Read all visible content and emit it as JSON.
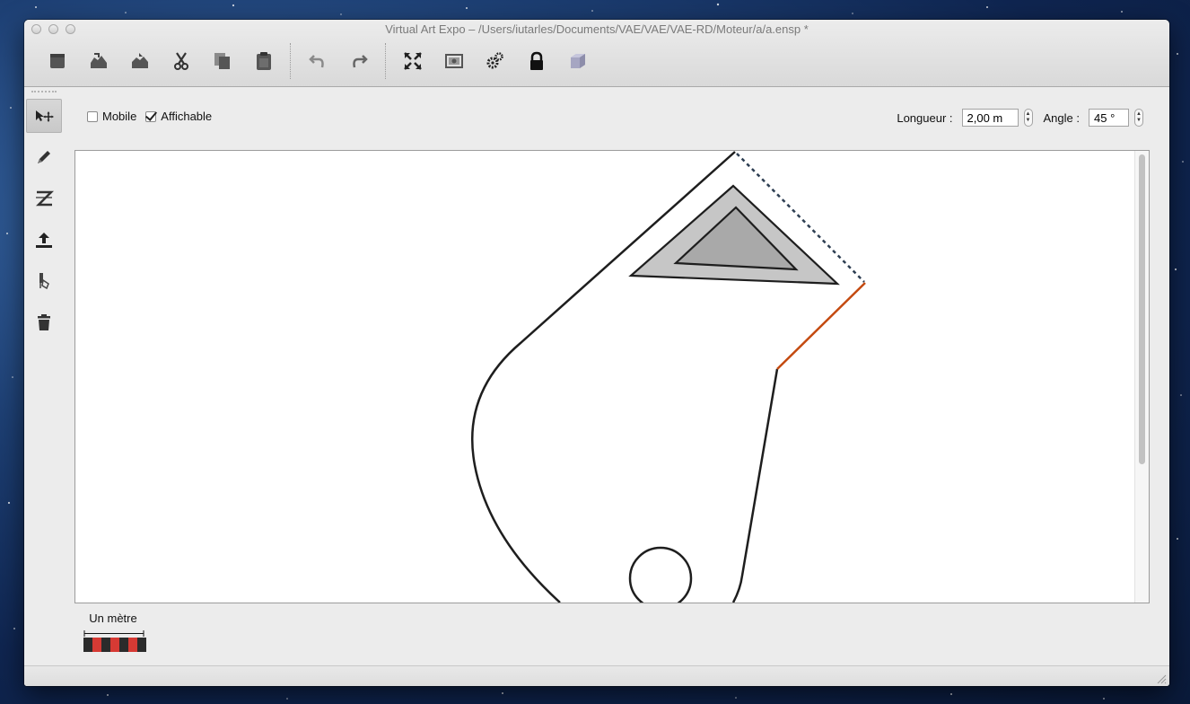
{
  "window": {
    "title": "Virtual Art Expo – /Users/iutarles/Documents/VAE/VAE/VAE-RD/Moteur/a/a.ensp *"
  },
  "toolbar": {
    "buttons": [
      {
        "name": "new",
        "icon": "new-document-icon"
      },
      {
        "name": "open",
        "icon": "open-icon"
      },
      {
        "name": "save",
        "icon": "save-icon"
      },
      {
        "name": "cut",
        "icon": "scissors-icon"
      },
      {
        "name": "copy",
        "icon": "copy-icon"
      },
      {
        "name": "paste",
        "icon": "clipboard-icon"
      },
      {
        "name": "undo",
        "icon": "undo-icon"
      },
      {
        "name": "redo",
        "icon": "redo-icon"
      },
      {
        "name": "fit-view",
        "icon": "expand-arrows-icon"
      },
      {
        "name": "snapshot",
        "icon": "camera-icon"
      },
      {
        "name": "settings",
        "icon": "gears-icon"
      },
      {
        "name": "lock",
        "icon": "lock-icon"
      },
      {
        "name": "3d-view",
        "icon": "cube-icon"
      }
    ]
  },
  "side_tools": [
    {
      "name": "select-move",
      "icon": "select-move-icon",
      "active": true
    },
    {
      "name": "pencil",
      "icon": "pencil-icon",
      "active": false
    },
    {
      "name": "zigzag-wall",
      "icon": "zigzag-icon",
      "active": false
    },
    {
      "name": "upload",
      "icon": "upload-icon",
      "active": false
    },
    {
      "name": "paint",
      "icon": "paint-brush-icon",
      "active": false
    },
    {
      "name": "delete",
      "icon": "trash-icon",
      "active": false
    }
  ],
  "options": {
    "mobile": {
      "label": "Mobile",
      "checked": false
    },
    "affichable": {
      "label": "Affichable",
      "checked": true
    }
  },
  "fields": {
    "length": {
      "label": "Longueur :",
      "value": "2,00 m"
    },
    "angle": {
      "label": "Angle :",
      "value": "45 °"
    }
  },
  "scale": {
    "label": "Un mètre",
    "colors": [
      "#2b2b2b",
      "#d63a34"
    ]
  },
  "colors": {
    "selected_segment": "#c44a10",
    "wall": "#1e1e1e",
    "dashed_wall": "#2d3e52",
    "triangle_outer": "#c6c6c6",
    "triangle_inner": "#a9a9a9"
  }
}
